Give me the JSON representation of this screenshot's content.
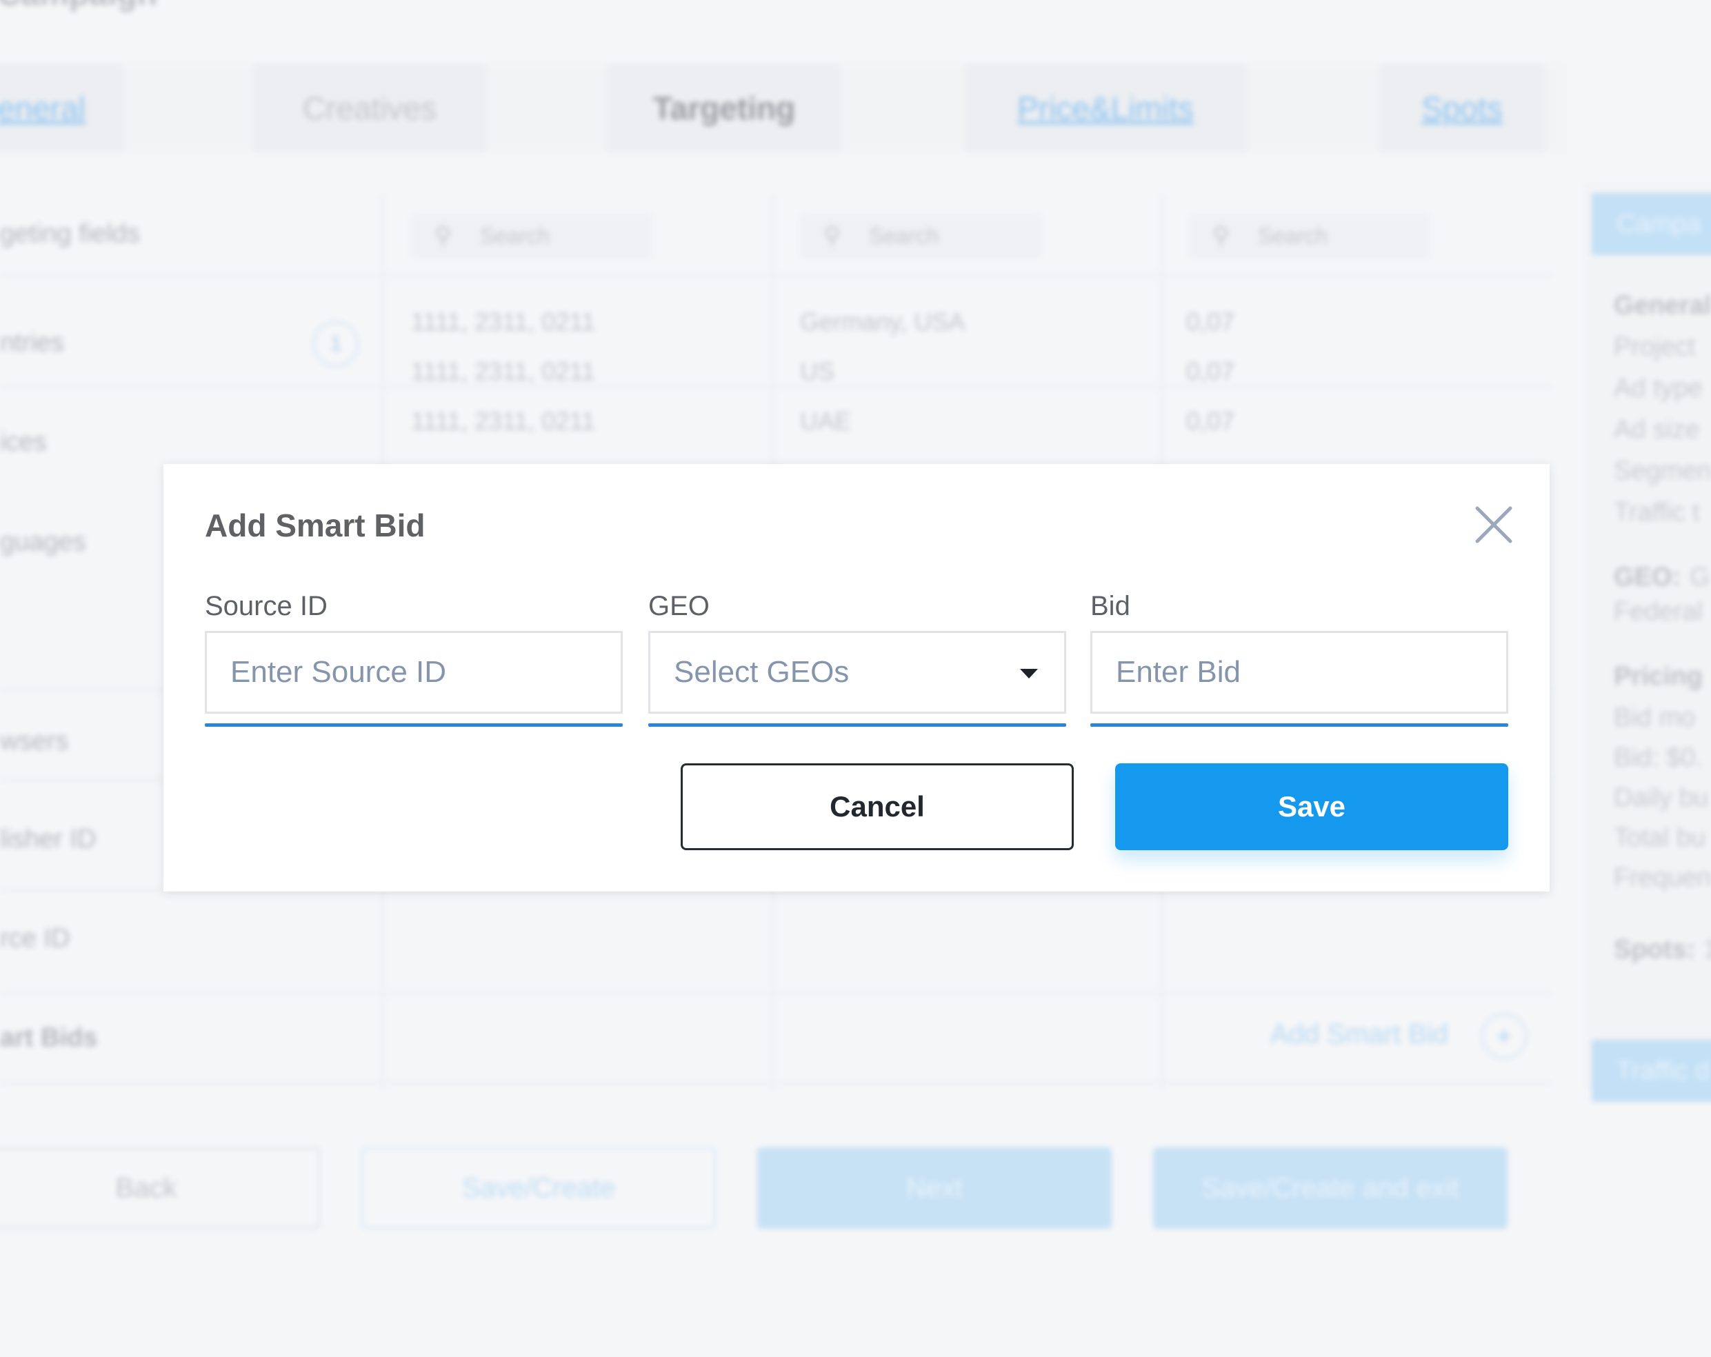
{
  "background": {
    "page_title": "te Campaign",
    "tabs": [
      "eneral",
      "Creatives",
      "Targeting",
      "Price&Limits",
      "Spots"
    ],
    "row_labels": [
      "geting fields",
      "ntries",
      "ices",
      "guages",
      "wsers",
      "lisher ID",
      "rce ID",
      "art Bids"
    ],
    "countries_count": "1",
    "search_placeholders": [
      "Search",
      "Search",
      "Search"
    ],
    "table_rows": [
      {
        "source": "1111, 2311, 0211",
        "geo": "Germany, USA",
        "bid": "0,07"
      },
      {
        "source": "1111, 2311, 0211",
        "geo": "US",
        "bid": "0,07"
      },
      {
        "source": "1111, 2311, 0211",
        "geo": "UAE",
        "bid": "0,07"
      }
    ],
    "add_smart_bid_link": "Add Smart Bid",
    "plus_symbol": "+",
    "bottom_buttons": {
      "back": "Back",
      "save_create": "Save/Create",
      "next": "Next",
      "save_create_exit": "Save/Create and exit"
    },
    "side_panel": {
      "header": "Campa",
      "general_heading": "General",
      "lines": [
        "Project",
        "Ad type",
        "Ad size",
        "Segmen",
        "Traffic t"
      ],
      "geo_heading": "GEO:",
      "geo_value": "G",
      "geo_line2": "Federal",
      "pricing_heading": "Pricing",
      "pricing_lines": [
        "Bid mo",
        "Bid: $0.",
        "Daily bu",
        "Total bu",
        "Frequen"
      ],
      "spots_heading": "Spots:",
      "spots_value": "1",
      "footer_header": "Traffic d"
    }
  },
  "modal": {
    "title": "Add Smart Bid",
    "fields": {
      "source_id": {
        "label": "Source ID",
        "placeholder": "Enter Source ID"
      },
      "geo": {
        "label": "GEO",
        "placeholder": "Select GEOs"
      },
      "bid": {
        "label": "Bid",
        "placeholder": "Enter Bid"
      }
    },
    "cancel_label": "Cancel",
    "save_label": "Save"
  },
  "colors": {
    "accent": "#1499ee",
    "underline": "#2a86dd",
    "placeholder": "#8595ab",
    "title": "#5f6165"
  },
  "icons": {
    "close": "close-icon",
    "dropdown": "chevron-down-icon",
    "search": "search-icon"
  }
}
